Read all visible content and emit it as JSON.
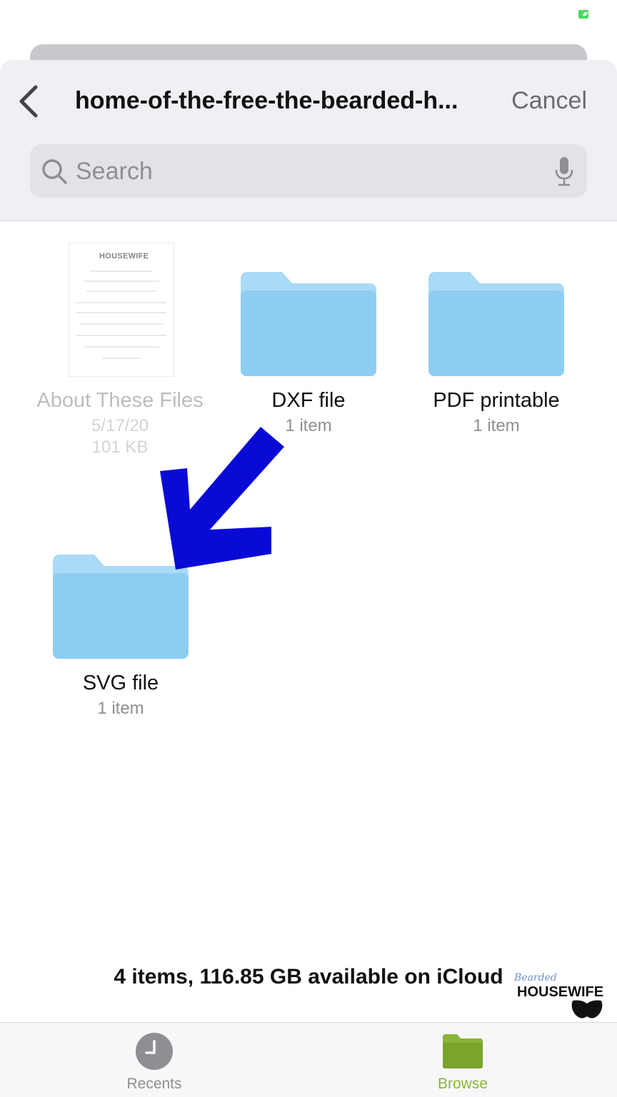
{
  "nav": {
    "title": "home-of-the-free-the-bearded-h...",
    "cancel_label": "Cancel"
  },
  "search": {
    "placeholder": "Search"
  },
  "files": [
    {
      "name": "About These Files",
      "date": "5/17/20",
      "size": "101 KB",
      "type": "document",
      "logo_text": "HOUSEWIFE"
    },
    {
      "name": "DXF file",
      "meta": "1 item",
      "type": "folder"
    },
    {
      "name": "PDF printable",
      "meta": "1 item",
      "type": "folder"
    },
    {
      "name": "SVG file",
      "meta": "1 item",
      "type": "folder"
    }
  ],
  "summary": "4 items, 116.85 GB available on iCloud",
  "watermark": {
    "script": "Bearded",
    "word": "HOUSEWIFE"
  },
  "tabs": [
    {
      "label": "Recents",
      "icon": "clock-icon"
    },
    {
      "label": "Browse",
      "icon": "folder-icon",
      "selected": true
    }
  ],
  "colors": {
    "folder": "#8ecdf3",
    "folder_tab": "#a9daf6",
    "accent_browse": "#8ab33a",
    "arrow": "#0a0ad6",
    "battery": "#4cd964"
  }
}
